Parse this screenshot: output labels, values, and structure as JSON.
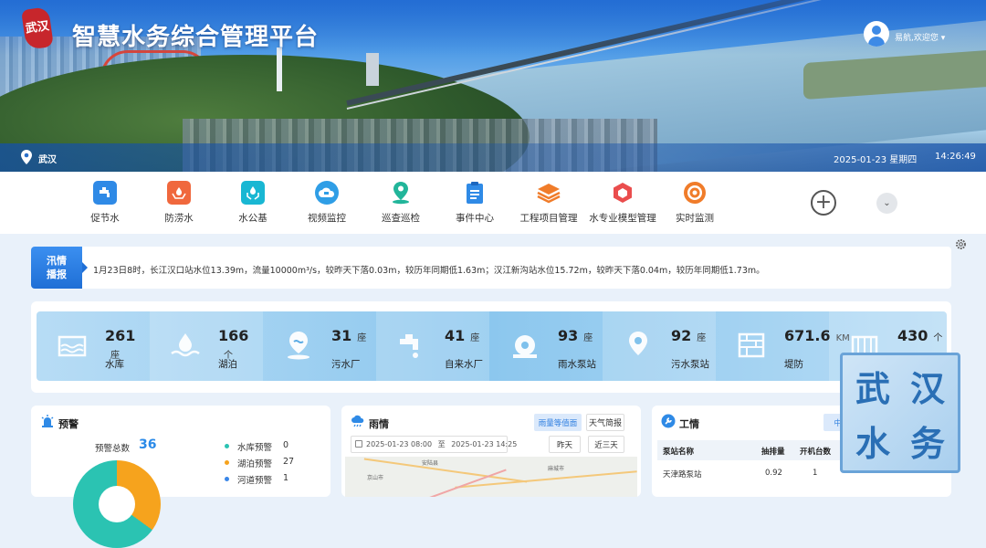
{
  "header": {
    "logo_text": "武汉",
    "title": "智慧水务综合管理平台",
    "user": "易航,欢迎您",
    "location": "武汉",
    "date": "2025-01-23 星期四",
    "time": "14:26:49"
  },
  "nav": {
    "items": [
      {
        "label": "促节水",
        "icon": "faucet-icon",
        "color": "#2f8ae6"
      },
      {
        "label": "防涝水",
        "icon": "flood-hands-icon",
        "color": "#f0683d"
      },
      {
        "label": "水公基",
        "icon": "water-hands-icon",
        "color": "#19b7d3"
      },
      {
        "label": "视频监控",
        "icon": "camera-cloud-icon",
        "color": "#2f9ee6"
      },
      {
        "label": "巡查巡检",
        "icon": "location-pin-icon",
        "color": "#21b59a"
      },
      {
        "label": "事件中心",
        "icon": "clipboard-icon",
        "color": "#2f8ae6"
      },
      {
        "label": "工程项目管理",
        "icon": "layers-icon",
        "color": "#f07c2a"
      },
      {
        "label": "水专业模型管理",
        "icon": "cube-icon",
        "color": "#ea4d4d"
      },
      {
        "label": "实时监测",
        "icon": "target-icon",
        "color": "#f07c2a"
      }
    ]
  },
  "flood": {
    "tag_line1": "汛情",
    "tag_line2": "播报",
    "text": "1月23日8时，长江汉口站水位13.39m，流量10000m³/s，较昨天下落0.03m，较历年同期低1.63m；汉江新沟站水位15.72m，较昨天下落0.04m，较历年同期低1.73m。"
  },
  "stats": [
    {
      "value": "261",
      "unit": "座",
      "label": "水库",
      "icon": "reservoir-icon"
    },
    {
      "value": "166",
      "unit": "个",
      "label": "湖泊",
      "icon": "lake-icon"
    },
    {
      "value": "31",
      "unit": "座",
      "label": "污水厂",
      "icon": "sewage-plant-icon"
    },
    {
      "value": "41",
      "unit": "座",
      "label": "自来水厂",
      "icon": "tap-water-icon"
    },
    {
      "value": "93",
      "unit": "座",
      "label": "雨水泵站",
      "icon": "rain-pump-icon"
    },
    {
      "value": "92",
      "unit": "座",
      "label": "污水泵站",
      "icon": "sewage-pump-icon"
    },
    {
      "value": "671.6",
      "unit": "KM",
      "label": "堤防",
      "icon": "embankment-icon"
    },
    {
      "value": "430",
      "unit": "个",
      "label": "",
      "icon": "gate-icon"
    }
  ],
  "warning": {
    "title": "预警",
    "total_label": "预警总数",
    "total": "36",
    "items": [
      {
        "label": "水库预警",
        "count": "0",
        "color": "#2bc3b2"
      },
      {
        "label": "湖泊预警",
        "count": "27",
        "color": "#f6a31d"
      },
      {
        "label": "河道预警",
        "count": "1",
        "color": "#3a86e8"
      }
    ]
  },
  "rain": {
    "title": "雨情",
    "btn_isoline": "雨量等值面",
    "btn_weather": "天气简报",
    "date_from": "2025-01-23 08:00",
    "date_sep": "至",
    "date_to": "2025-01-23 14:25",
    "btn_today": "昨天",
    "btn_3days": "近三天",
    "map_labels": [
      "安陆县",
      "京山市",
      "麻城市"
    ]
  },
  "work": {
    "title": "工情",
    "btn": "中心",
    "columns": [
      "泵站名称",
      "抽排量",
      "开机台数"
    ],
    "rows": [
      {
        "name": "天津路泵站",
        "volume": "0.92",
        "units": "1"
      }
    ]
  },
  "seal": {
    "chars": [
      "武",
      "汉",
      "水",
      "务"
    ]
  }
}
